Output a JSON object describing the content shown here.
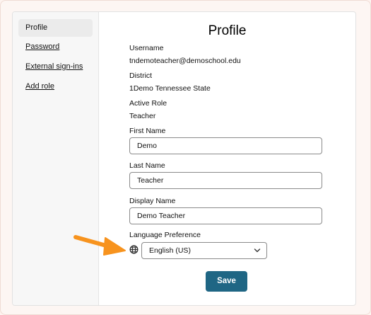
{
  "sidebar": {
    "items": [
      {
        "label": "Profile"
      },
      {
        "label": "Password"
      },
      {
        "label": "External sign-ins"
      },
      {
        "label": "Add role"
      }
    ]
  },
  "page": {
    "title": "Profile"
  },
  "fields": {
    "username": {
      "label": "Username",
      "value": "tndemoteacher@demoschool.edu"
    },
    "district": {
      "label": "District",
      "value": "1Demo Tennessee State"
    },
    "active_role": {
      "label": "Active Role",
      "value": "Teacher"
    },
    "first_name": {
      "label": "First Name",
      "value": "Demo"
    },
    "last_name": {
      "label": "Last Name",
      "value": "Teacher"
    },
    "display_name": {
      "label": "Display Name",
      "value": "Demo Teacher"
    },
    "language": {
      "label": "Language Preference",
      "value": "English (US)"
    }
  },
  "save_label": "Save",
  "colors": {
    "accent": "#1f6684",
    "annotation_arrow": "#f7931e"
  }
}
